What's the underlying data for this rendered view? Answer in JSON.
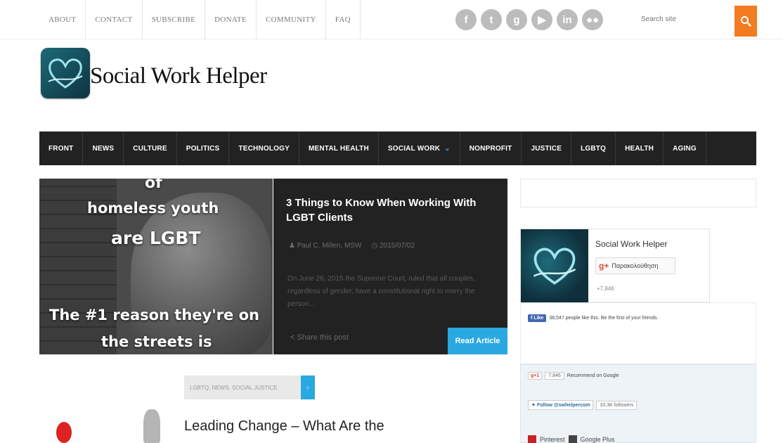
{
  "topnav": {
    "links": [
      "ABOUT",
      "CONTACT",
      "SUBSCRIBE",
      "DONATE",
      "COMMUNITY",
      "FAQ"
    ],
    "social_icons": [
      "facebook-icon",
      "twitter-icon",
      "google-plus-icon",
      "youtube-icon",
      "linkedin-icon",
      "flickr-icon"
    ],
    "search_placeholder": "Search site"
  },
  "site": {
    "title": "Social Work Helper"
  },
  "mainnav": {
    "items": [
      "FRONT",
      "NEWS",
      "CULTURE",
      "POLITICS",
      "TECHNOLOGY",
      "MENTAL HEALTH",
      "SOCIAL WORK",
      "NONPROFIT",
      "JUSTICE",
      "LGBTQ",
      "HEALTH",
      "AGING"
    ]
  },
  "featured": {
    "image_text": {
      "line1": "of",
      "line2": "homeless youth",
      "line3": "are LGBT",
      "line4": "The #1 reason they're on",
      "line5": "the streets is"
    },
    "title": "3 Things to Know When Working With LGBT Clients",
    "author": "Paul C. Millen, MSW",
    "date": "2015/07/02",
    "excerpt": "On June 26, 2015 the Supreme Court, ruled that all couples, regardless of gender, have a constitutional right to marry the person...",
    "share_label": "Share this post",
    "read_label": "Read Article"
  },
  "article": {
    "categories": "LGBTQ, NEWS, SOCIAL JUSTICE",
    "title": "Leading Change – What Are the"
  },
  "sidebar": {
    "gplus_card": {
      "name": "Social Work Helper",
      "follow_label": "Παρακολούθηση",
      "count": "+7,846"
    },
    "facebook": {
      "like_label": "Like",
      "text": "38,547 people like this. Be the first of your friends."
    },
    "google": {
      "badge": "g+1",
      "count": "7,846",
      "text": "Recommend on Google"
    },
    "twitter": {
      "follow_label": "Follow @swhelpercom",
      "followers": "33.3K followers"
    },
    "links": {
      "pinterest": "Pinterest",
      "google_plus": "Google Plus"
    }
  },
  "colors": {
    "accent_orange": "#f47b20",
    "accent_blue": "#2aa8e0",
    "nav_dark": "#222222"
  }
}
